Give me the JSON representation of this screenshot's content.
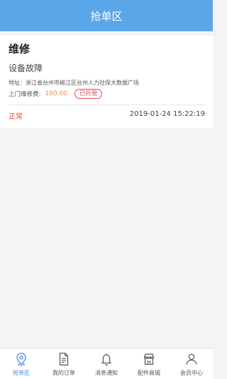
{
  "header": {
    "title": "抢单区"
  },
  "order": {
    "title": "维修",
    "subtitle": "设备故障",
    "address": "地址：浙江省台州市椒江区台州人力社保大数据广场",
    "fee_label": "上门维修费:",
    "fee_value": "100.00",
    "fee_badge": "已托管",
    "status": "正常",
    "time": "2019-01-24 15:22:19"
  },
  "tabbar": {
    "items": [
      {
        "label": "抢单区",
        "icon": "location-pin-icon",
        "active": true
      },
      {
        "label": "我的订单",
        "icon": "document-icon",
        "active": false
      },
      {
        "label": "消息通知",
        "icon": "bell-icon",
        "active": false
      },
      {
        "label": "配件商城",
        "icon": "store-icon",
        "active": false
      },
      {
        "label": "会员中心",
        "icon": "user-icon",
        "active": false
      }
    ]
  },
  "colors": {
    "header_bg": "#5aa6e8",
    "active_tab": "#4a90e2",
    "status_red": "#e04b4b",
    "fee_orange": "#f08a54"
  }
}
